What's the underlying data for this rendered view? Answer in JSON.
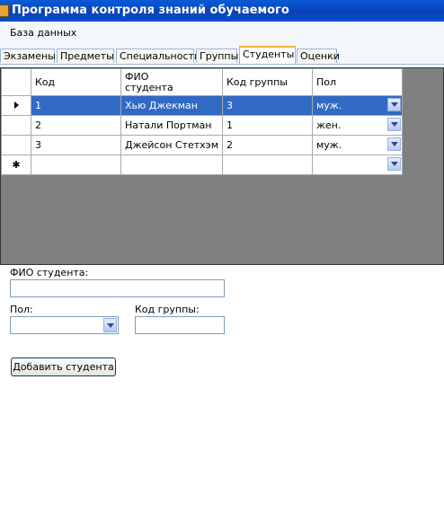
{
  "window": {
    "title": "Программа контроля знаний обучаемого"
  },
  "menu": {
    "items": [
      "База данных"
    ]
  },
  "tabs": [
    {
      "label": "Экзамены"
    },
    {
      "label": "Предметы"
    },
    {
      "label": "Специальности"
    },
    {
      "label": "Группы"
    },
    {
      "label": "Студенты",
      "active": true
    },
    {
      "label": "Оценки"
    }
  ],
  "grid": {
    "columns": [
      "Код",
      "ФИО студента",
      "Код группы",
      "Пол"
    ],
    "column_header_fio_line1": "ФИО",
    "column_header_fio_line2": "студента",
    "rows": [
      {
        "code": "1",
        "fio": "Хью Джекман",
        "group": "3",
        "sex": "муж.",
        "selected": true
      },
      {
        "code": "2",
        "fio": "Натали Портман",
        "group": "1",
        "sex": "жен."
      },
      {
        "code": "3",
        "fio": "Джейсон Стетхэм",
        "group": "2",
        "sex": "муж."
      }
    ],
    "new_row_marker": "✱"
  },
  "form": {
    "fio_label": "ФИО студента:",
    "fio_value": "",
    "sex_label": "Пол:",
    "sex_value": "",
    "group_label": "Код группы:",
    "group_value": "",
    "add_button": "Добавить студента"
  },
  "colors": {
    "title_bar": "#0741b8",
    "selection": "#316ac5",
    "grid_background": "#808080"
  }
}
